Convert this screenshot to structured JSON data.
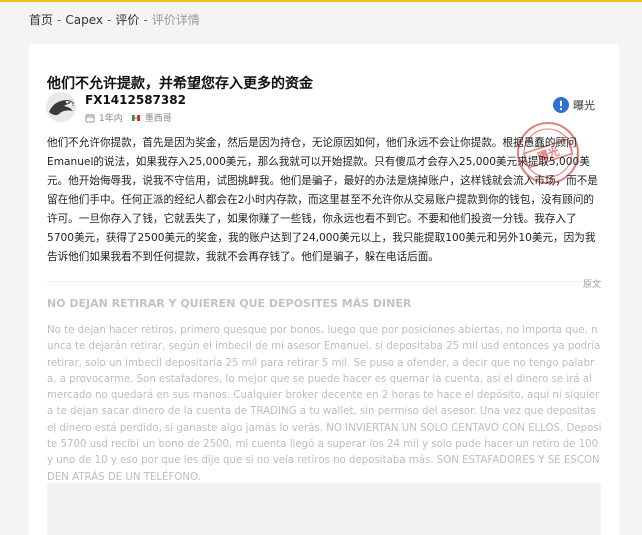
{
  "breadcrumb": {
    "items": [
      "首页",
      "Capex",
      "评价",
      "评价详情"
    ],
    "separator": "-"
  },
  "article": {
    "title": "他们不允许提款，并希望您存入更多的资金",
    "author": {
      "name": "FX1412587382",
      "duration": "1年内",
      "country": "墨西哥"
    },
    "expose_label": "曝光",
    "stamp_text": "曝光",
    "body_cn": "他们不允许你提款，首先是因为奖金，然后是因为持仓，无论原因如何，他们永远不会让你提款。根据愚蠢的顾问Emanuel的说法，如果我存入25,000美元，那么我就可以开始提款。只有傻瓜才会存入25,000美元来提取5,000美元。他开始侮辱我，说我不守信用，试图挑衅我。他们是骗子，最好的办法是烧掉账户，这样钱就会流入市场，而不是留在他们手中。任何正派的经纪人都会在2小时内存款，而这里甚至不允许你从交易账户提款到你的钱包，没有顾问的许可。一旦你存入了钱，它就丢失了，如果你赚了一些钱，你永远也看不到它。不要和他们投资一分钱。我存入了5700美元，获得了2500美元的奖金，我的账户达到了24,000美元以上，我只能提取100美元和另外10美元，因为我告诉他们如果我看不到任何提款，我就不会再存钱了。他们是骗子，躲在电话后面。",
    "original_tag": "原文",
    "original_title": "NO DEJAN RETIRAR Y QUIEREN QUE DEPOSITES MÁS DINER",
    "body_es": "No te dejan hacer retiros, primero quesque por bonos, luego que por posiciones abiertas, no importa que, nunca te dejarán retirar, según el imbecil de mi asesor Emanuel, si depositaba 25 mil usd entonces ya podría retirar, solo un imbecil depositaría 25 mil para retirar 5 mil. Se puso a ofender, a decir que no tengo palabra, a provocarme. Son estafadores, lo mejor que se puede hacer es quemar la cuenta, así el dinero se irá al mercado no quedará en sus manos. Cualquier broker decente en 2 horas te hace el depósito, aquí ni siquiera te dejan sacar dinero de la cuenta de TRADING a tu wallet, sin permiso del asesor. Una vez que depositas el dinero está perdido, si ganaste algo jamás lo verás. NO INVIERTAN UN SOLO CENTAVO CON ELLOS. Deposite 5700 usd recibi un bono de 2500, mi cuenta llegó a superar los 24 mil y solo pude hacer un retiro de 100 y uno de 10 y eso por que les dije que si no veía retiros no depositaba más. SON ESTAFADORES Y SE ESCONDEN ATRÁS DE UN TELÉFONO."
  },
  "colors": {
    "accent_yellow": "#f0c419",
    "expose_blue": "#2f6fd8",
    "stamp_red": "#d9534f"
  },
  "icons": [
    "clock-icon",
    "flag-icon",
    "expose-icon",
    "eagle-avatar"
  ]
}
